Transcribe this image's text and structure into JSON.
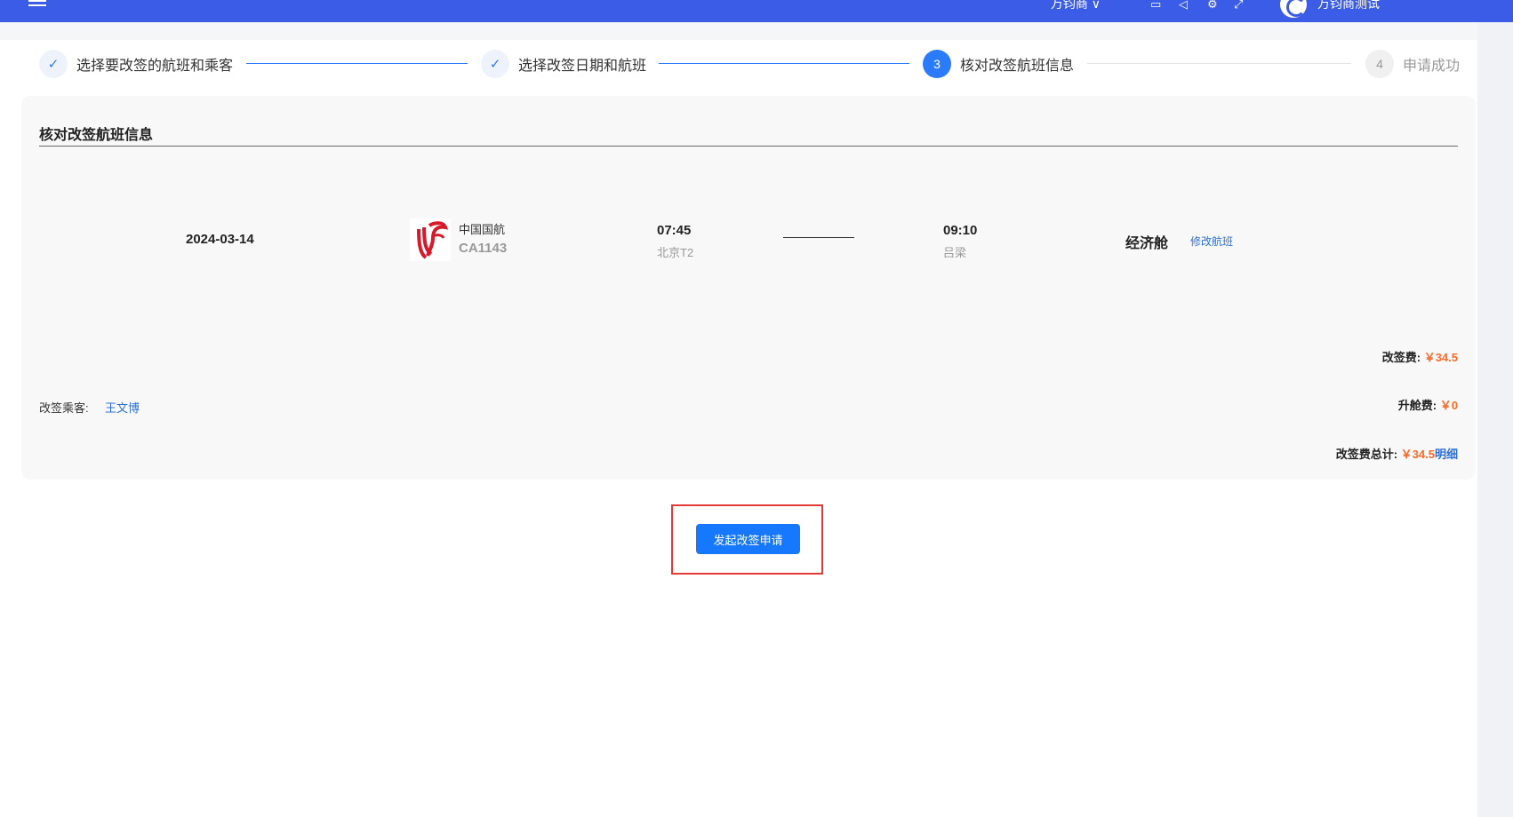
{
  "topbar": {
    "dropdown_label": "万钧商 ∨",
    "username": "万钧商测试"
  },
  "steps": [
    {
      "index": "✓",
      "label": "选择要改签的航班和乘客",
      "status": "done"
    },
    {
      "index": "✓",
      "label": "选择改签日期和航班",
      "status": "done"
    },
    {
      "index": "3",
      "label": "核对改签航班信息",
      "status": "active"
    },
    {
      "index": "4",
      "label": "申请成功",
      "status": "todo"
    }
  ],
  "panel": {
    "title": "核对改签航班信息",
    "flight": {
      "date": "2024-03-14",
      "airline": "中国国航",
      "flight_no": "CA1143",
      "dep_time": "07:45",
      "dep_airport": "北京T2",
      "arr_time": "09:10",
      "arr_airport": "吕梁",
      "cabin": "经济舱",
      "modify_label": "修改航班"
    },
    "fees": {
      "change_fee_label": "改签费:",
      "change_fee": "￥34.5",
      "upgrade_fee_label": "升舱费:",
      "upgrade_fee": "￥0",
      "total_label": "改签费总计:",
      "total": "￥34.5",
      "detail_label": "明细"
    },
    "passenger": {
      "label": "改签乘客:",
      "name": "王文博"
    }
  },
  "submit_label": "发起改签申请",
  "colors": {
    "topbar": "#3b5ce6",
    "primary": "#1677ff",
    "fee": "#ff6a2b",
    "highlight": "#e53935"
  }
}
